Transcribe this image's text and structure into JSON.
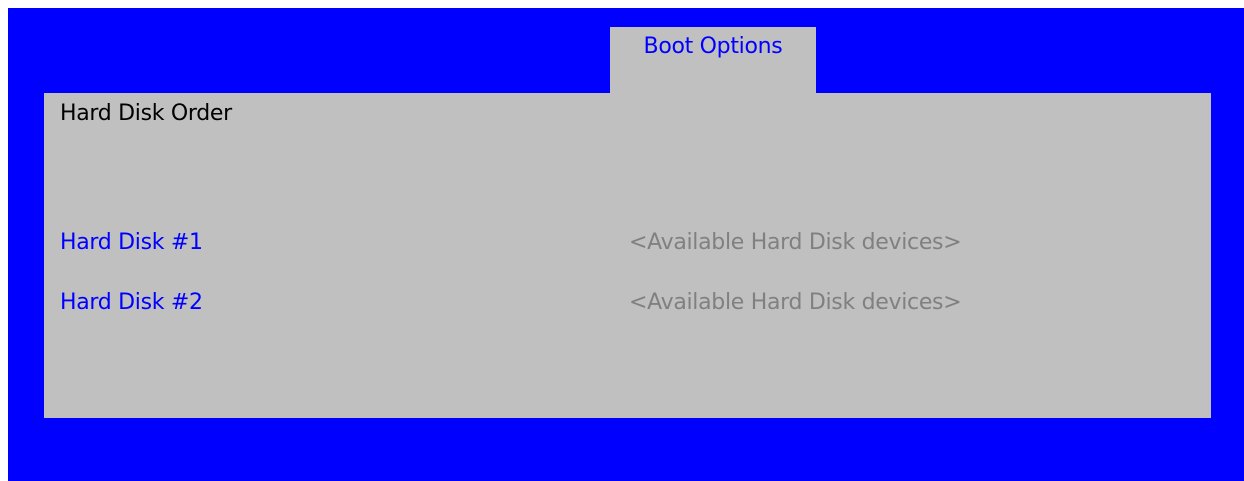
{
  "tab": {
    "label": "Boot Options"
  },
  "section": {
    "title": "Hard Disk Order"
  },
  "rows": [
    {
      "label": "Hard Disk #1",
      "value": "<Available Hard Disk devices>"
    },
    {
      "label": "Hard Disk #2",
      "value": "<Available Hard Disk devices>"
    }
  ],
  "colors": {
    "background": "#0000ff",
    "panel": "#c0c0c0",
    "label": "#0000ff",
    "value": "#808080",
    "title": "#000000"
  }
}
